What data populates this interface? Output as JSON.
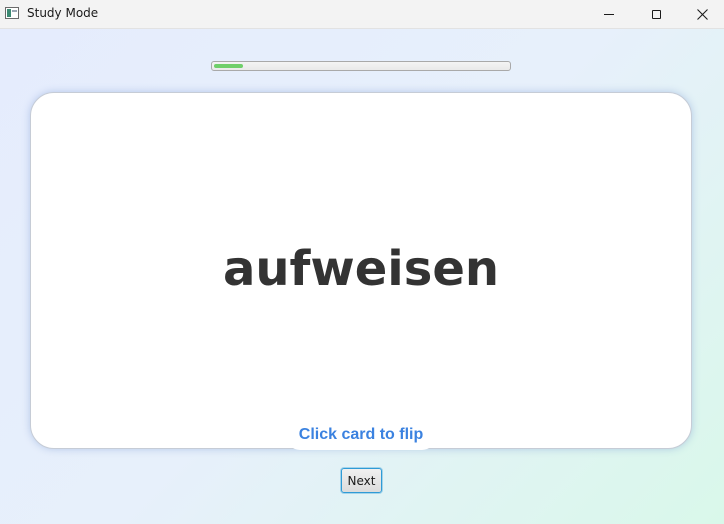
{
  "window": {
    "title": "Study Mode",
    "icons": {
      "app": "app-window-icon",
      "minimize": "minimize-icon",
      "maximize": "maximize-icon",
      "close": "close-icon"
    },
    "close_glyph": "✕"
  },
  "study": {
    "progress_fraction": 0.1,
    "progress_color": "#6fcf6a",
    "card": {
      "word": "aufweisen"
    },
    "flip_hint": "Click card to flip",
    "hint_color": "#3b82e0",
    "next_label": "Next",
    "accent_color": "#2f9bd6"
  }
}
